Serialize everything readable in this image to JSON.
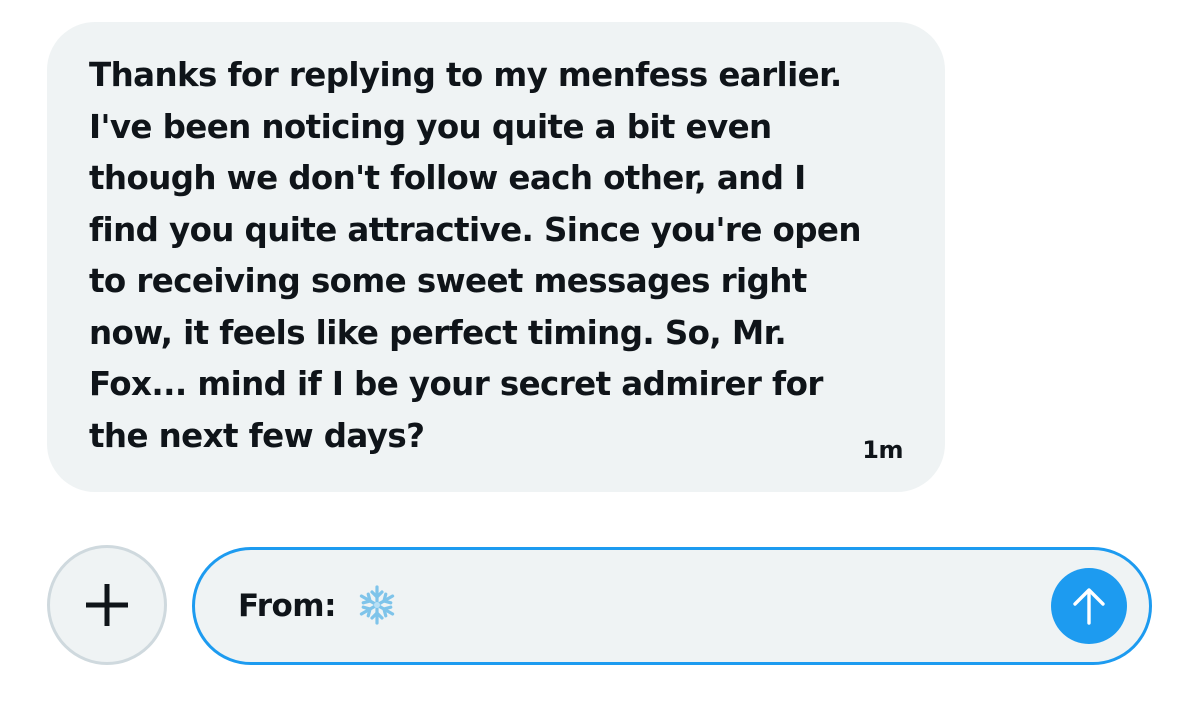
{
  "conversation": {
    "message": {
      "text": "Thanks for replying to my menfess earlier.\nI've been noticing you quite a bit even\nthough we don't follow each other, and I\nfind you quite attractive. Since you're open\nto receiving some sweet messages right\nnow, it feels like perfect timing. So, Mr.\nFox... mind if I be your secret admirer for\nthe next few days?",
      "timestamp": "1m",
      "bubble_color": "#eff3f4"
    }
  },
  "composer": {
    "add_icon": "plus-icon",
    "input_value": "From: ",
    "input_emoji": "snowflake-icon",
    "send_icon": "arrow-up-icon",
    "accent_color": "#1d9bf0"
  }
}
